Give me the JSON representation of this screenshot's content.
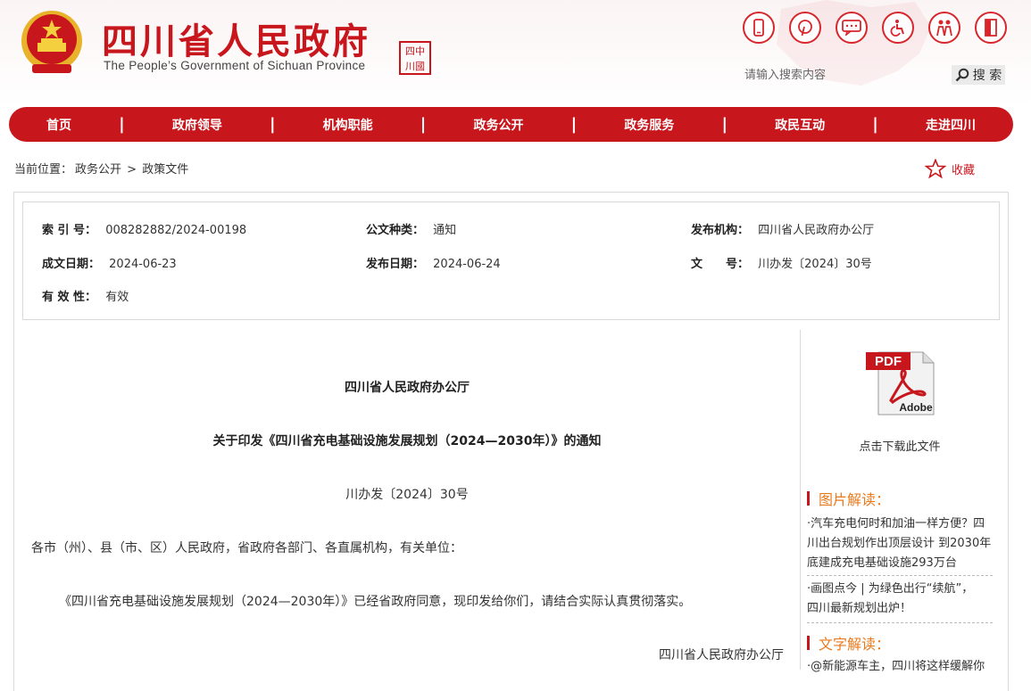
{
  "colors": {
    "brand_red": "#c8161d",
    "accent_orange": "#e87a1e"
  },
  "header": {
    "title": "四川省人民政府",
    "subtitle": "The People’s Government of Sichuan Province",
    "seal_text": "四川中國",
    "icons": [
      "mobile-icon",
      "pinterest-icon",
      "message-icon",
      "accessibility-icon",
      "elderly-care-icon",
      "exit-icon"
    ],
    "search": {
      "placeholder": "请输入搜索内容",
      "button_label": "搜 索"
    }
  },
  "nav": {
    "items": [
      "首页",
      "政府领导",
      "机构职能",
      "政务公开",
      "政务服务",
      "政民互动",
      "走进四川"
    ]
  },
  "breadcrumb": {
    "prefix": "当前位置：",
    "items": [
      "政务公开",
      "政策文件"
    ],
    "separator": ">"
  },
  "favorite": {
    "label": "收藏"
  },
  "meta": {
    "index_label": "索 引 号：",
    "index_value": "008282882/2024-00198",
    "type_label": "公文种类：",
    "type_value": "通知",
    "org_label": "发布机构：",
    "org_value": "四川省人民政府办公厅",
    "date_label": "成文日期：",
    "date_value": "2024-06-23",
    "pub_label": "发布日期：",
    "pub_value": "2024-06-24",
    "docno_label": "文　　号：",
    "docno_value": "川办发〔2024〕30号",
    "valid_label": "有 效 性：",
    "valid_value": "有效"
  },
  "doc": {
    "issuer": "四川省人民政府办公厅",
    "title": "关于印发《四川省充电基础设施发展规划（2024—2030年）》的通知",
    "number": "川办发〔2024〕30号",
    "salutation": "各市（州）、县（市、区）人民政府，省政府各部门、各直属机构，有关单位：",
    "body": "《四川省充电基础设施发展规划（2024—2030年）》已经省政府同意，现印发给你们，请结合实际认真贯彻落实。",
    "signature": "四川省人民政府办公厅"
  },
  "sidebar": {
    "pdf_badge": "PDF",
    "pdf_brand": "Adobe",
    "download_label": "点击下载此文件",
    "picture_heading": "图片解读：",
    "picture_items": [
      [
        "·汽车充电何时和加油一样方便？四",
        "川出台规划作出顶层设计 到2030年",
        "底建成充电基础设施293万台"
      ],
      [
        "·画图点今 | 为绿色出行“续航”，",
        "四川最新规划出炉！"
      ]
    ],
    "text_heading": "文字解读：",
    "text_items": [
      "·@新能源车主，四川将这样缓解你"
    ]
  }
}
